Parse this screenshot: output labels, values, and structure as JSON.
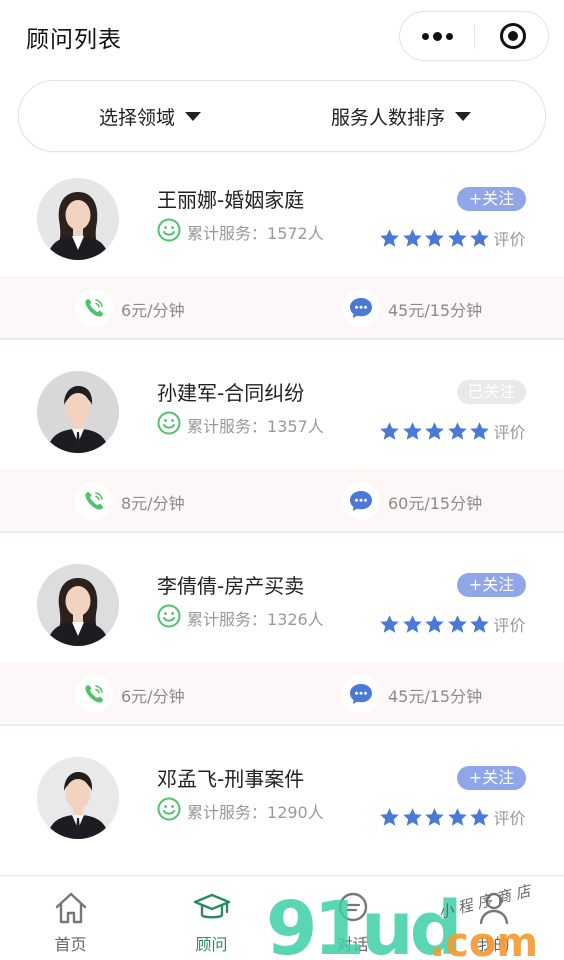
{
  "navbar": {
    "title": "顾问列表",
    "more_icon": "more-dots-icon",
    "close_icon": "target-icon"
  },
  "filter": {
    "domain_label": "选择领域",
    "sort_label": "服务人数排序"
  },
  "advisors": [
    {
      "name": "王丽娜-婚姻家庭",
      "served_prefix": "累计服务：",
      "served": "1572人",
      "follow": "+关注",
      "followed": false,
      "stars": 5,
      "rating_label": "评价",
      "call_price": "6元/分钟",
      "chat_price": "45元/15分钟",
      "gender": "female"
    },
    {
      "name": "孙建军-合同纠纷",
      "served_prefix": "累计服务：",
      "served": "1357人",
      "follow": "已关注",
      "followed": true,
      "stars": 5,
      "rating_label": "评价",
      "call_price": "8元/分钟",
      "chat_price": "60元/15分钟",
      "gender": "male"
    },
    {
      "name": "李倩倩-房产买卖",
      "served_prefix": "累计服务：",
      "served": "1326人",
      "follow": "+关注",
      "followed": false,
      "stars": 5,
      "rating_label": "评价",
      "call_price": "6元/分钟",
      "chat_price": "45元/15分钟",
      "gender": "female"
    },
    {
      "name": "邓孟飞-刑事案件",
      "served_prefix": "累计服务：",
      "served": "1290人",
      "follow": "+关注",
      "followed": false,
      "stars": 5,
      "rating_label": "评价",
      "call_price": "",
      "chat_price": "",
      "gender": "male"
    }
  ],
  "tabbar": {
    "items": [
      {
        "label": "首页",
        "icon": "home-icon",
        "active": false
      },
      {
        "label": "顾问",
        "icon": "graduation-cap-icon",
        "active": true
      },
      {
        "label": "对话",
        "icon": "chat-icon",
        "active": false
      },
      {
        "label": "我的",
        "icon": "user-icon",
        "active": false
      }
    ]
  },
  "watermark": {
    "text": "91ud.com",
    "caption": "小程序商店"
  },
  "colors": {
    "star": "#4a79d8",
    "follow_active": "#8fa7e8",
    "follow_inactive": "#e9e9e9",
    "tab_active": "#2e8a5f",
    "smile": "#4fc26b",
    "call_icon": "#4fc26b",
    "chat_icon": "#4a79d8"
  }
}
